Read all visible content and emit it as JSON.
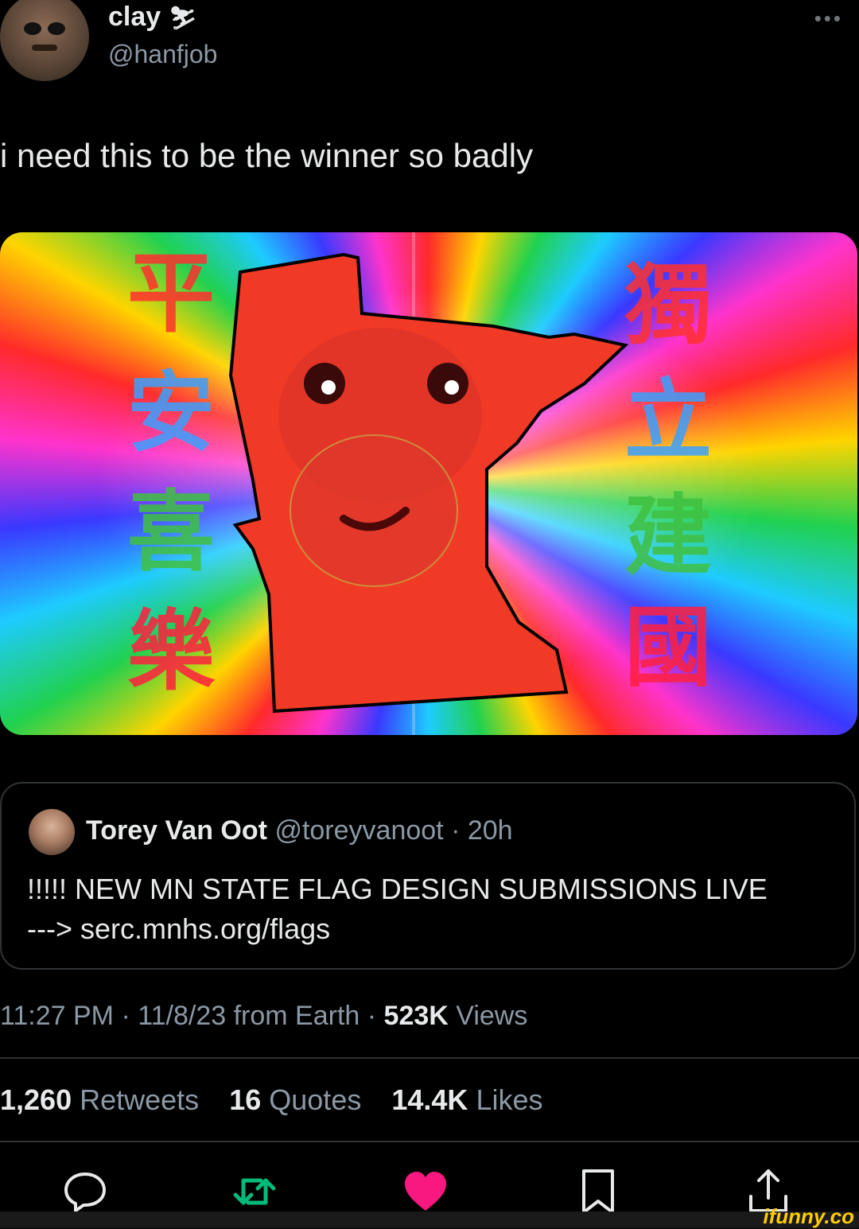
{
  "author": {
    "name": "clay",
    "emoji": "⛷",
    "handle": "@hanfjob"
  },
  "more_label": "•••",
  "tweet": {
    "text": "i need this to be the winner so badly"
  },
  "media": {
    "left_characters": [
      "平",
      "安",
      "喜",
      "樂"
    ],
    "right_characters": [
      "獨",
      "立",
      "建",
      "國"
    ],
    "shape_color": "#f03a26"
  },
  "quote": {
    "name": "Torey Van Oot",
    "handle": "@toreyvanoot",
    "separator": " · ",
    "time": "20h",
    "text_line1": "!!!!! NEW MN STATE FLAG DESIGN SUBMISSIONS LIVE",
    "text_line2": "---> serc.mnhs.org/flags"
  },
  "meta": {
    "time": "11:27 PM",
    "date": "11/8/23",
    "source": "from Earth",
    "views_count": "523K",
    "views_label": "Views"
  },
  "stats": [
    {
      "count": "1,260",
      "label": "Retweets"
    },
    {
      "count": "16",
      "label": "Quotes"
    },
    {
      "count": "14.4K",
      "label": "Likes"
    }
  ],
  "colors": {
    "like": "#f91880",
    "retweet": "#00ba7c",
    "muted": "#8b98a5"
  },
  "watermark": "ifunny.co"
}
